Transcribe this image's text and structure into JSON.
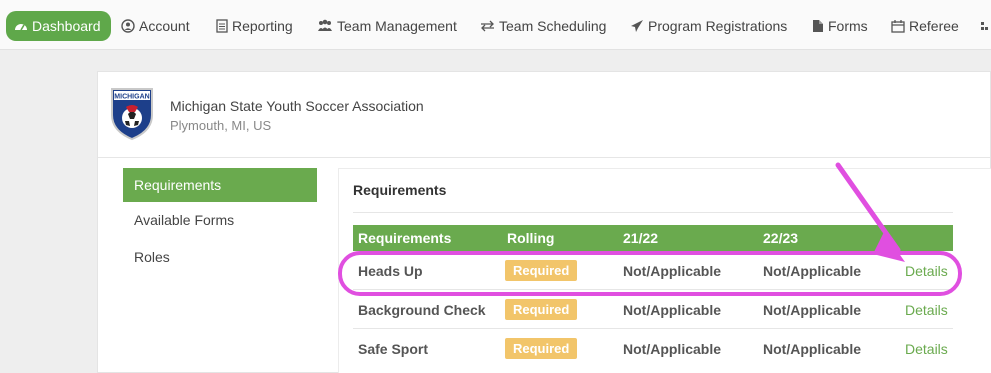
{
  "nav": {
    "items": [
      {
        "label": "Dashboard",
        "icon": "dashboard-icon",
        "active": true
      },
      {
        "label": "Account",
        "icon": "user-circle-icon"
      },
      {
        "label": "Reporting",
        "icon": "document-icon"
      },
      {
        "label": "Team Management",
        "icon": "users-icon"
      },
      {
        "label": "Team Scheduling",
        "icon": "exchange-icon"
      },
      {
        "label": "Program Registrations",
        "icon": "paper-plane-icon"
      },
      {
        "label": "Forms",
        "icon": "file-icon"
      },
      {
        "label": "Referee",
        "icon": "calendar-icon"
      }
    ]
  },
  "org": {
    "name": "Michigan State Youth Soccer Association",
    "location": "Plymouth, MI, US",
    "logo_text": "MICHIGAN"
  },
  "sidebar": {
    "items": [
      {
        "label": "Requirements",
        "active": true
      },
      {
        "label": "Available Forms"
      },
      {
        "label": "Roles"
      }
    ]
  },
  "panel": {
    "title": "Requirements",
    "columns": [
      "Requirements",
      "Rolling",
      "21/22",
      "22/23"
    ],
    "rows": [
      {
        "name": "Heads Up",
        "rolling": "Required",
        "y2122": "Not/Applicable",
        "y2223": "Not/Applicable",
        "action": "Details",
        "highlighted": true
      },
      {
        "name": "Background Check",
        "rolling": "Required",
        "y2122": "Not/Applicable",
        "y2223": "Not/Applicable",
        "action": "Details"
      },
      {
        "name": "Safe Sport",
        "rolling": "Required",
        "y2122": "Not/Applicable",
        "y2223": "Not/Applicable",
        "action": "Details"
      }
    ]
  },
  "colors": {
    "accent_green": "#6aaa4e",
    "badge_yellow": "#f2c56a",
    "annotation_magenta": "#e04fe0"
  }
}
